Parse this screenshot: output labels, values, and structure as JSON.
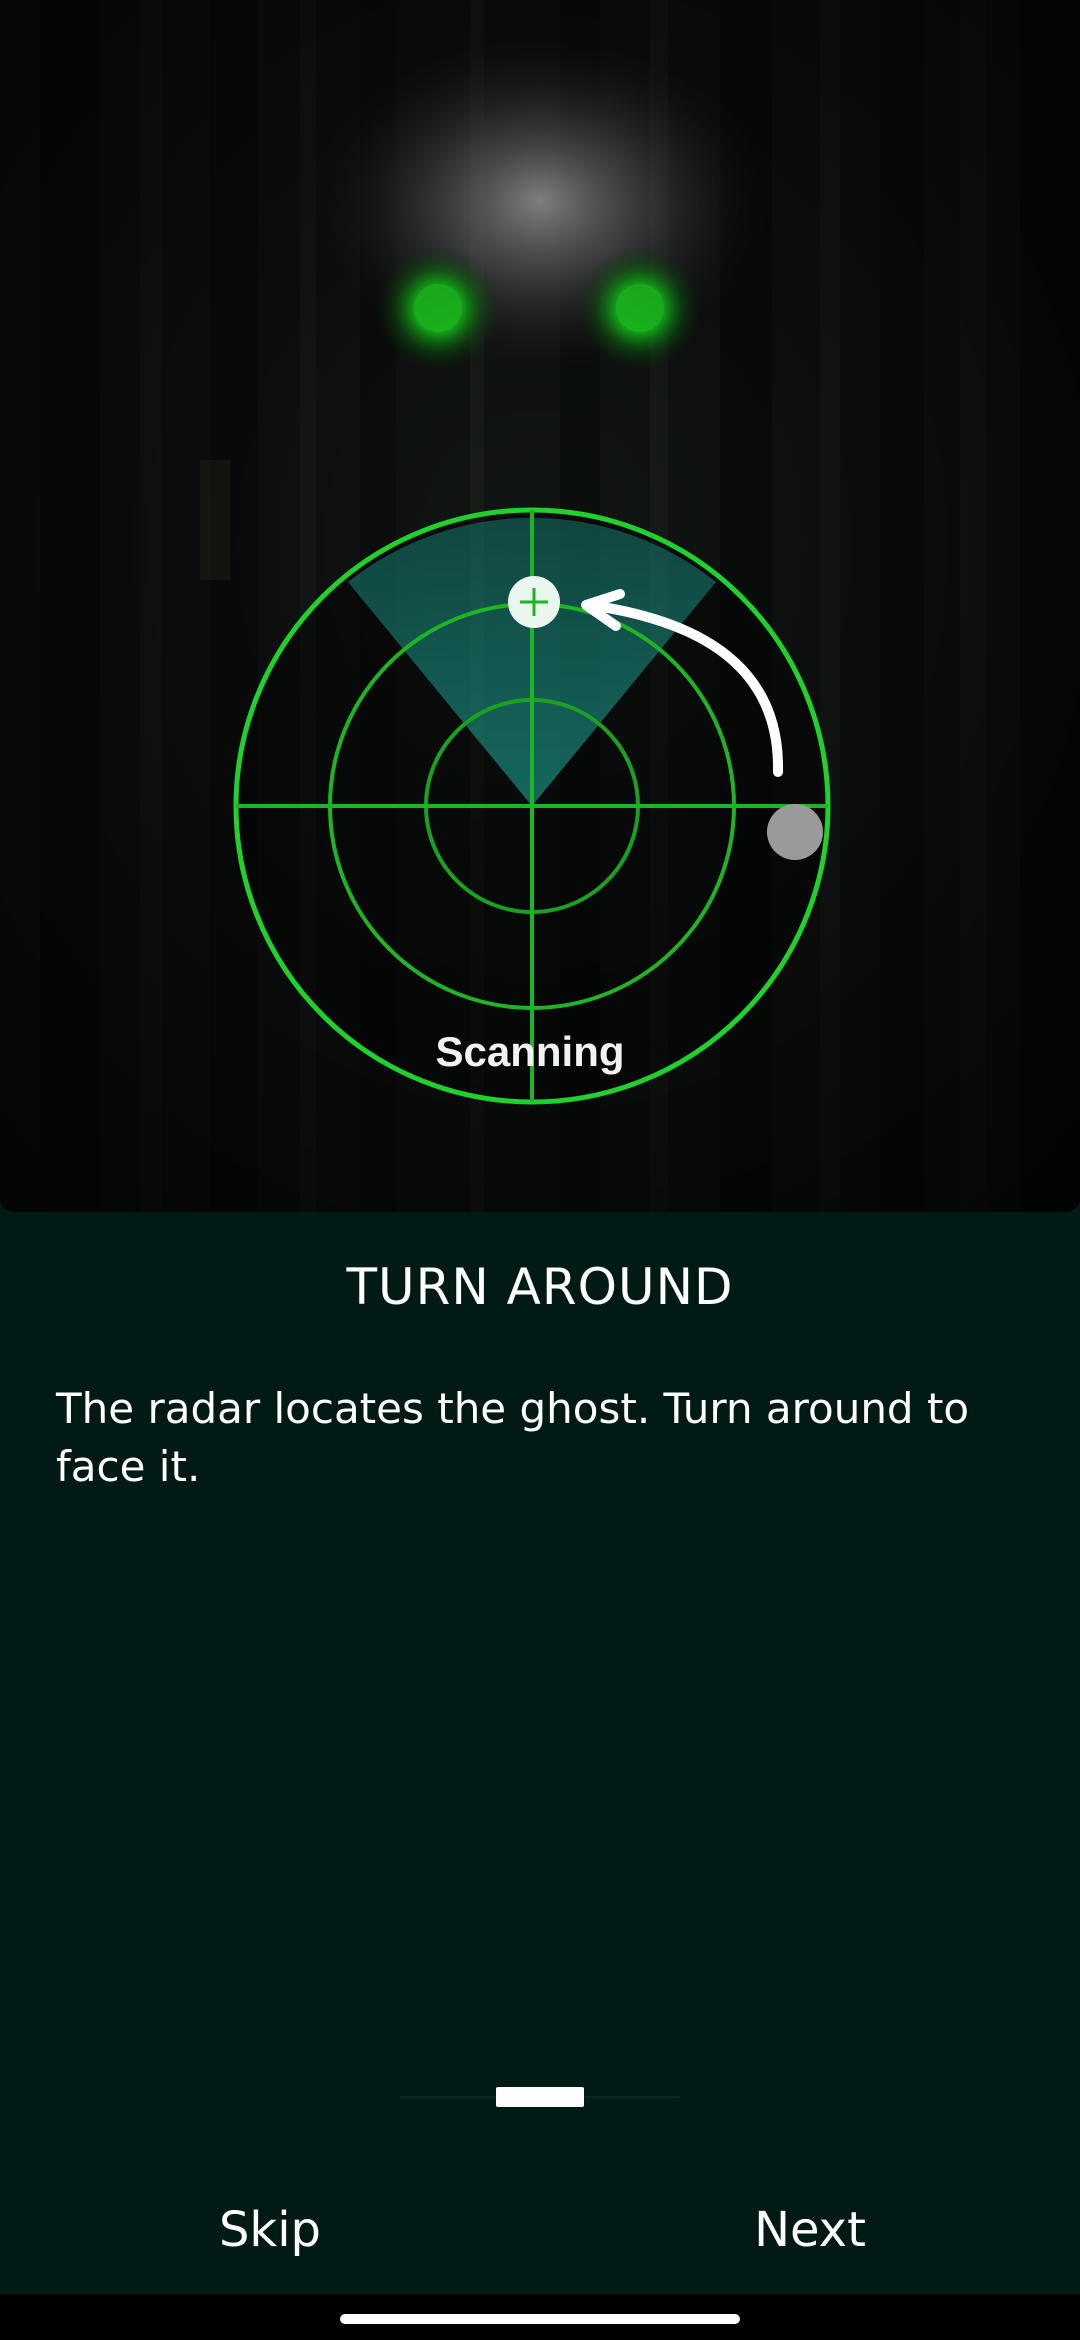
{
  "hero": {
    "radar_label": "Scanning",
    "radar_color": "#1fd12a",
    "eye_color": "#19e01f"
  },
  "onboarding": {
    "title": "TURN AROUND",
    "description": "The radar locates the ghost. Turn around to face it.",
    "page_indicator": {
      "current": 2
    }
  },
  "buttons": {
    "skip": "Skip",
    "next": "Next"
  },
  "colors": {
    "background": "#021a15",
    "text": "#ffffff"
  }
}
